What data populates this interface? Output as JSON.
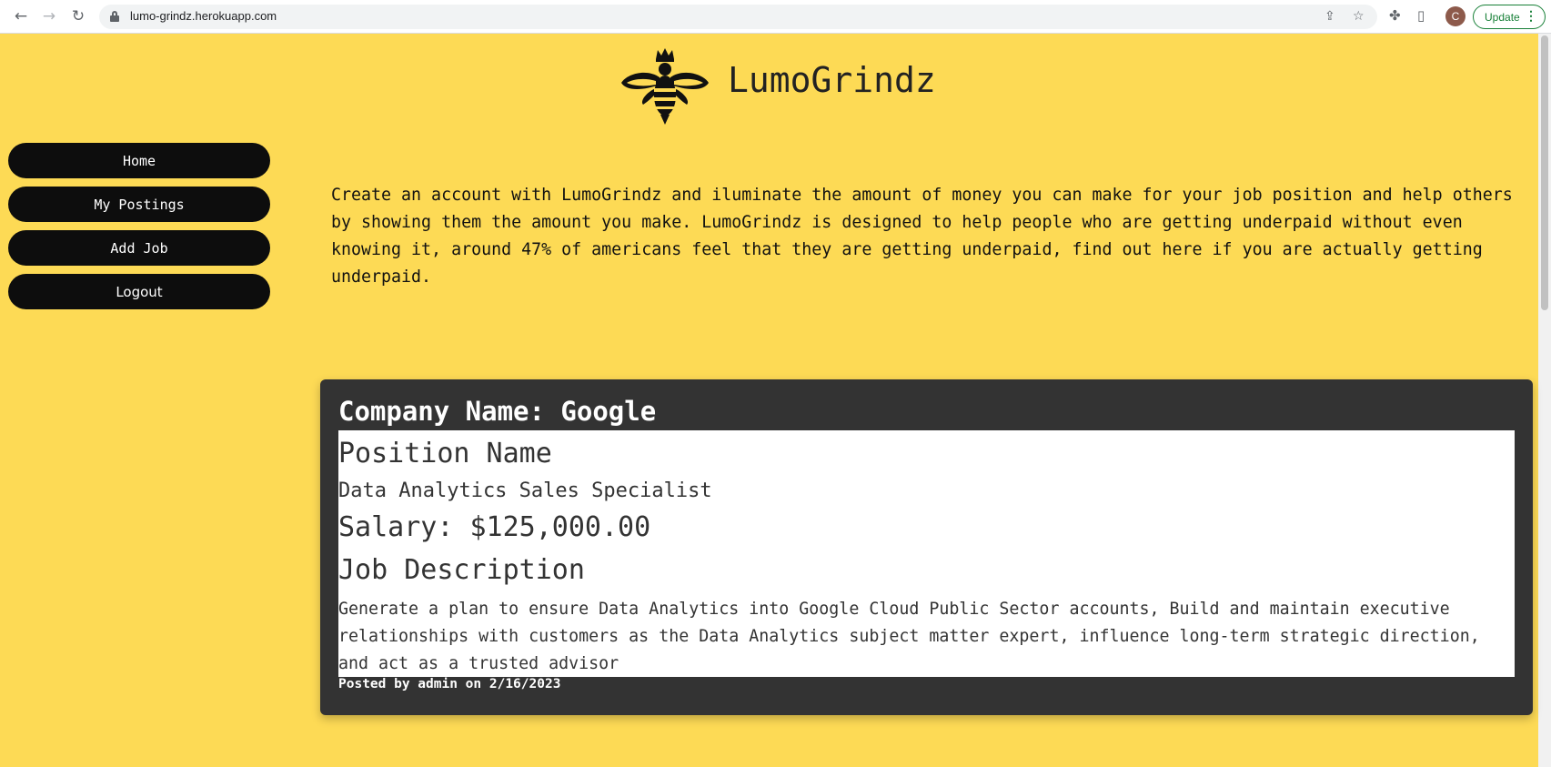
{
  "browser": {
    "url": "lumo-grindz.herokuapp.com",
    "profile_initial": "C",
    "update_label": "Update"
  },
  "header": {
    "title": "LumoGrindz"
  },
  "sidebar": {
    "items": [
      {
        "label": "Home"
      },
      {
        "label": "My Postings"
      },
      {
        "label": "Add Job"
      },
      {
        "label": "Logout"
      }
    ]
  },
  "intro": {
    "text": "Create an account with LumoGrindz and iluminate the amount of money you can make for your job position and help others by showing them the amount you make. LumoGrindz is designed to help people who are getting underpaid without even knowing it, around 47% of americans feel that they are getting underpaid, find out here if you are actually getting underpaid."
  },
  "job": {
    "company": "Company Name: Google",
    "position_label": "Position Name",
    "position_value": "Data Analytics Sales Specialist",
    "salary": "Salary: $125,000.00",
    "description_label": "Job Description",
    "description": "Generate a plan to ensure Data Analytics into Google Cloud Public Sector accounts, Build and maintain executive relationships with customers as the Data Analytics subject matter expert, influence long-term strategic direction, and act as a trusted advisor",
    "posted": "Posted by admin on 2/16/2023"
  },
  "colors": {
    "background": "#fdda55",
    "button": "#0d0d0d",
    "card": "#333333"
  }
}
